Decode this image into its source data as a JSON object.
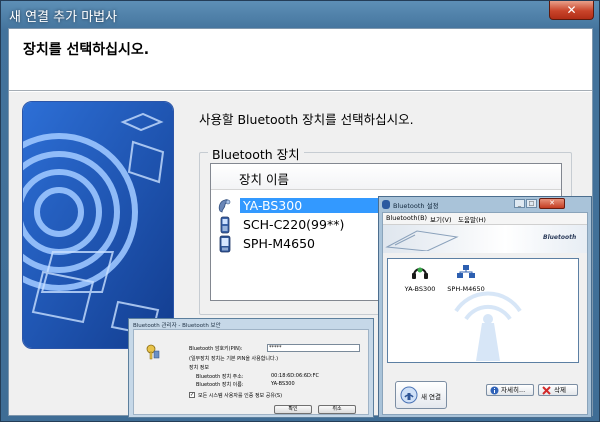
{
  "wizard": {
    "title": "새 연결 추가 마법사",
    "close_glyph": "✕",
    "heading": "장치를 선택하십시오.",
    "instruction": "사용할 Bluetooth 장치를 선택하십시오.",
    "group_label": "Bluetooth 장치",
    "column_header": "장치 이름",
    "devices": [
      {
        "name": "YA-BS300",
        "icon": "headset-icon",
        "selected": true
      },
      {
        "name": "SCH-C220(99**)",
        "icon": "cellphone-icon",
        "selected": false
      },
      {
        "name": "SPH-M4650",
        "icon": "pda-phone-icon",
        "selected": false
      }
    ]
  },
  "passkey_dialog": {
    "title": "Bluetooth 관리자 - Bluetooth 보안",
    "passkey_label": "Bluetooth 암호키(PIN):",
    "passkey_value": "*****",
    "passkey_hint": "(일부장치 장치는 기본 PIN을 사용합니다.)",
    "device_info_heading": "장치 정보",
    "address_label": "Bluetooth 장치 주소:",
    "address_value": "00:18:6D:06:6D:FC",
    "name_label": "Bluetooth 장치 이름:",
    "name_value": "YA-BS300",
    "checkbox_label": "모든 시스템 사용자를 인증 정보 공유(S)",
    "checkbox_checked": true,
    "checkbox_mark": "✓",
    "ok_label": "확인",
    "cancel_label": "취소"
  },
  "bt_window": {
    "title": "Bluetooth 설정",
    "minimize_glyph": "_",
    "maximize_glyph": "□",
    "close_glyph": "✕",
    "menu": [
      "Bluetooth(B)",
      "보기(V)",
      "도움말(H)"
    ],
    "brand": "Bluetooth",
    "devices": [
      {
        "label": "YA-BS300",
        "icon": "headset-icon"
      },
      {
        "label": "SPH-M4650",
        "icon": "network-icon"
      }
    ],
    "new_connection_label": "새 연결",
    "details_label": "자세히...",
    "delete_label": "삭제",
    "colors": {
      "accent": "#3399ff",
      "window_frame": "#43739c",
      "bt_blue": "#2c5aa0"
    }
  }
}
